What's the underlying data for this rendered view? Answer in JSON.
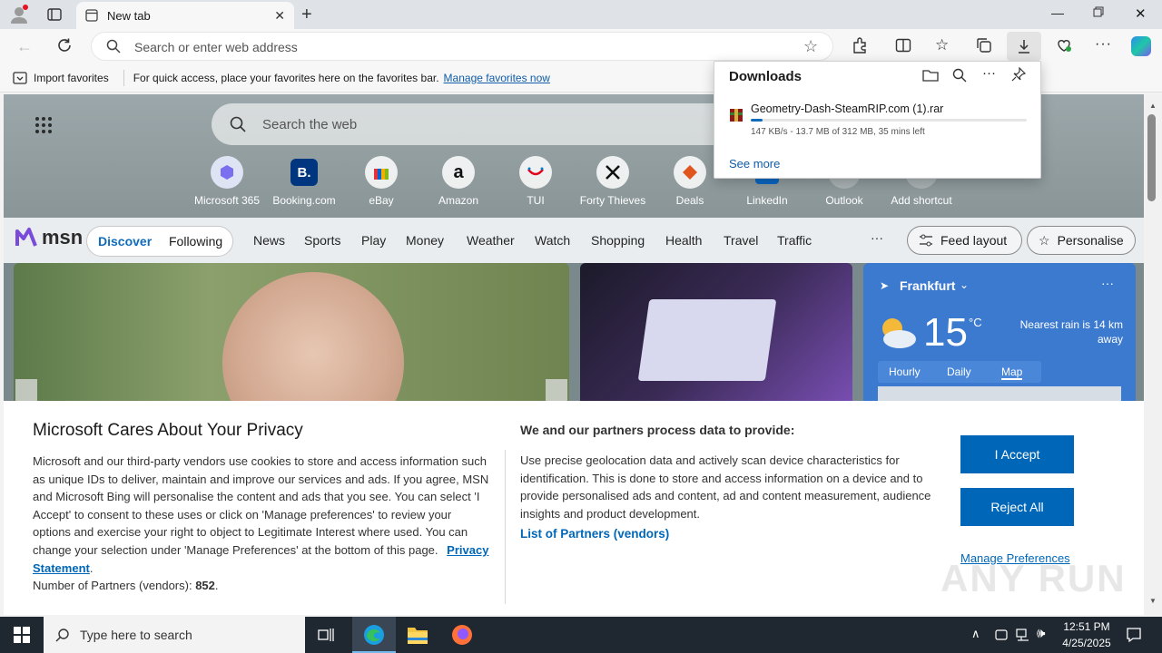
{
  "browser": {
    "tab_title": "New tab",
    "address_placeholder": "Search or enter web address"
  },
  "favorites_bar": {
    "import_label": "Import favorites",
    "hint": "For quick access, place your favorites here on the favorites bar.",
    "manage_link": "Manage favorites now"
  },
  "newtab": {
    "search_placeholder": "Search the web",
    "shortcuts": [
      {
        "label": "Microsoft 365",
        "icon": "microsoft365-icon"
      },
      {
        "label": "Booking.com",
        "icon": "booking-icon",
        "glyph": "B."
      },
      {
        "label": "eBay",
        "icon": "ebay-icon"
      },
      {
        "label": "Amazon",
        "icon": "amazon-icon",
        "glyph": "a"
      },
      {
        "label": "TUI",
        "icon": "tui-icon"
      },
      {
        "label": "Forty Thieves",
        "icon": "swords-icon"
      },
      {
        "label": "Deals",
        "icon": "tag-icon"
      },
      {
        "label": "LinkedIn",
        "icon": "linkedin-icon"
      },
      {
        "label": "Outlook",
        "icon": "outlook-icon"
      },
      {
        "label": "Add shortcut",
        "icon": "plus-icon",
        "glyph": "+"
      }
    ]
  },
  "msn": {
    "brand": "msn",
    "toggle": [
      "Discover",
      "Following"
    ],
    "nav": [
      "News",
      "Sports",
      "Play",
      "Money",
      "Weather",
      "Watch",
      "Shopping",
      "Health",
      "Travel",
      "Traffic"
    ],
    "more": "···",
    "feed_layout": "Feed layout",
    "personalise": "Personalise"
  },
  "weather": {
    "city": "Frankfurt",
    "temp": "15",
    "unit": "°C",
    "rain": "Nearest rain is 14 km away",
    "tabs": [
      "Hourly",
      "Daily",
      "Map"
    ],
    "selected_tab": "Map"
  },
  "privacy": {
    "title": "Microsoft Cares About Your Privacy",
    "body": "Microsoft and our third-party vendors use cookies to store and access information such as unique IDs to deliver, maintain and improve our services and ads. If you agree, MSN and Microsoft Bing will personalise the content and ads that you see. You can select 'I Accept' to consent to these uses or click on 'Manage preferences' to review your options and exercise your right to object to Legitimate Interest where used.  You can change your selection under 'Manage Preferences' at the bottom of this page.",
    "statement_link": "Privacy Statement",
    "partners_label": "Number of Partners (vendors):",
    "partners_count": "852",
    "right_title": "We and our partners process data to provide:",
    "right_body": "Use precise geolocation data and actively scan device characteristics for identification. This is done to store and access information on a device and to provide personalised ads and content, ad and content measurement, audience insights and product development.",
    "partners_link": "List of Partners (vendors)",
    "accept": "I Accept",
    "reject": "Reject All",
    "manage": "Manage Preferences"
  },
  "downloads": {
    "title": "Downloads",
    "file_name": "Geometry-Dash-SteamRIP.com (1).rar",
    "status": "147 KB/s - 13.7 MB of 312 MB, 35 mins left",
    "progress": 0.044,
    "see_more": "See more"
  },
  "taskbar": {
    "search_placeholder": "Type here to search",
    "time": "12:51 PM",
    "date": "4/25/2025"
  },
  "watermark": "ANY RUN",
  "colors": {
    "accent": "#0067b8",
    "msn_blue": "#0f6cbd",
    "taskbar": "#1f2730",
    "weather_bg": "#3c7ad0"
  }
}
